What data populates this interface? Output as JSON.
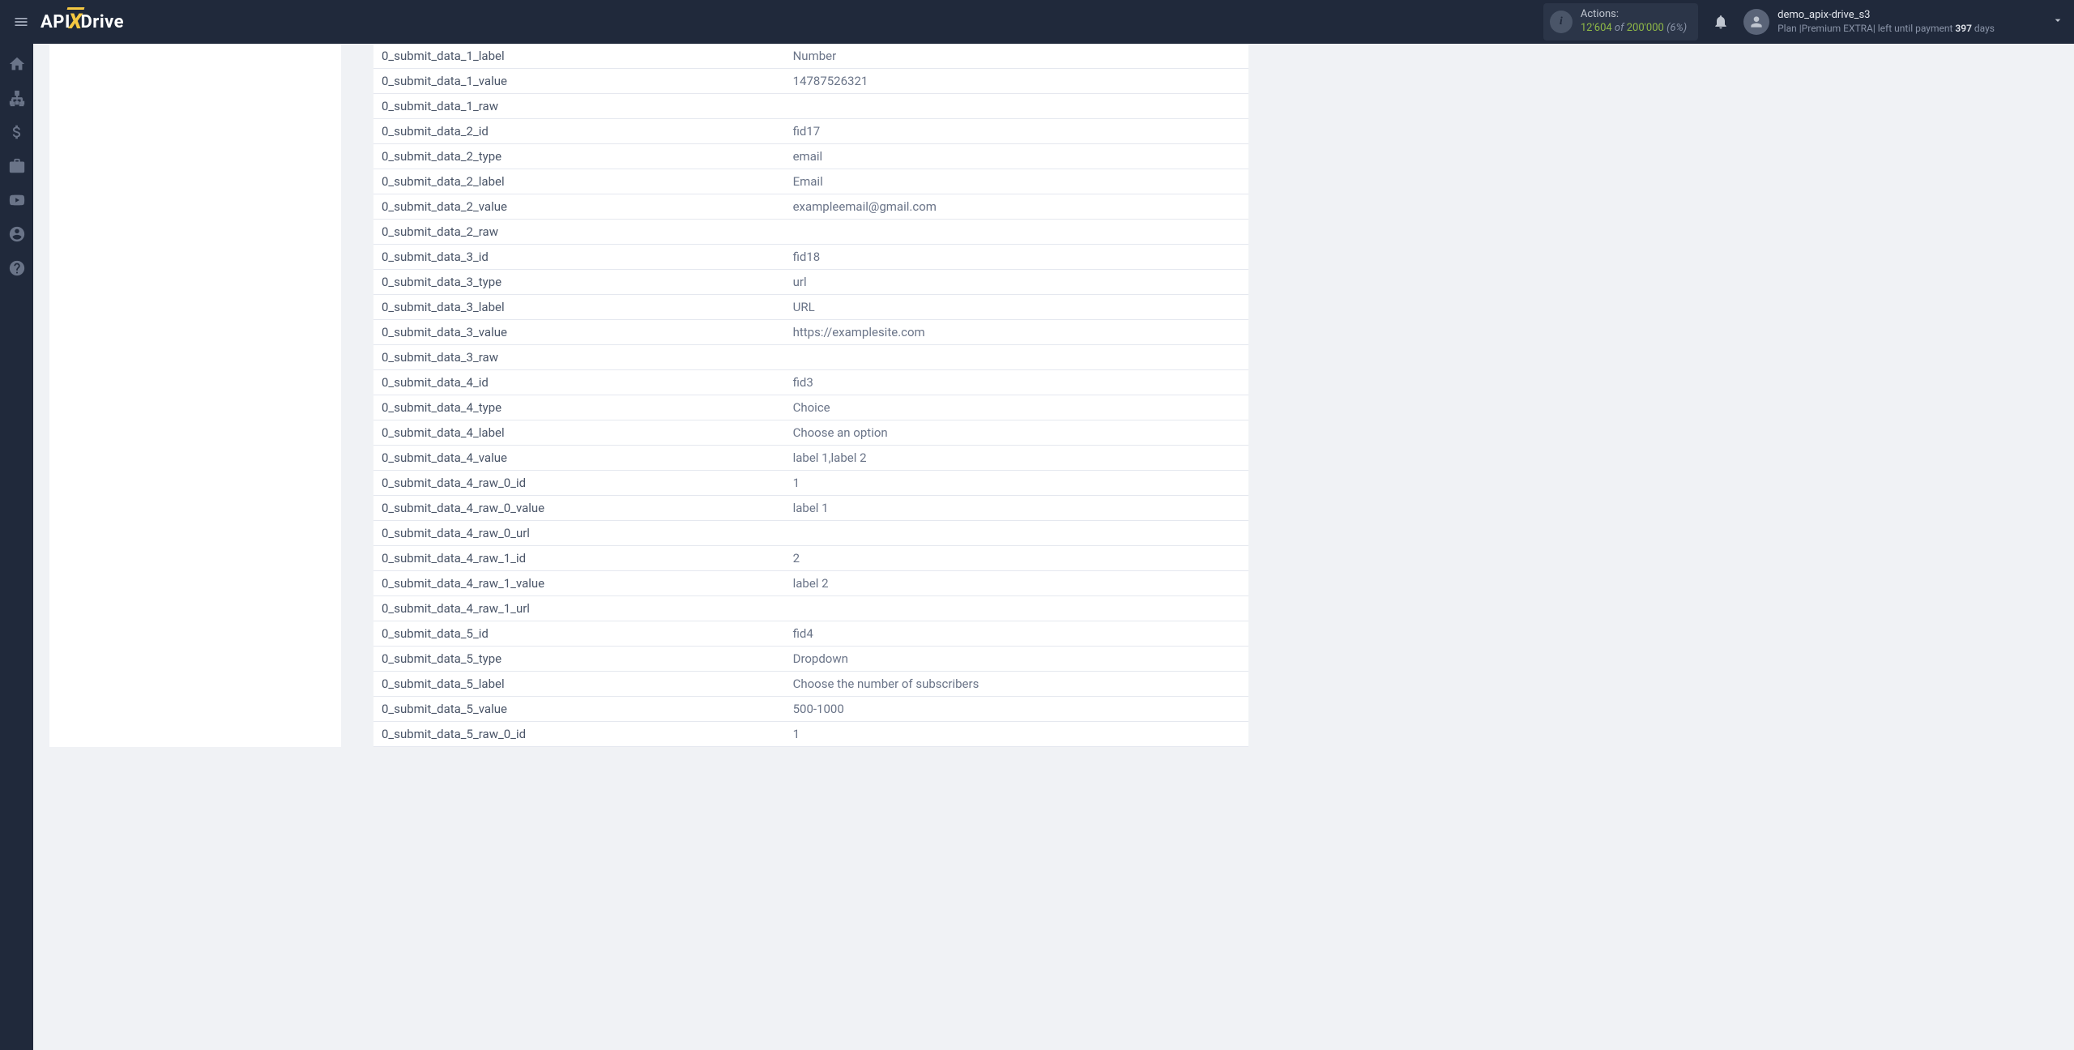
{
  "topbar": {
    "actions_label": "Actions:",
    "actions_n1": "12'604",
    "actions_of": "of",
    "actions_n2": "200'000",
    "actions_pct": "(6%)"
  },
  "user": {
    "name": "demo_apix-drive_s3",
    "plan_prefix": "Plan |",
    "plan_name": "Premium EXTRA",
    "plan_mid": "| left until payment ",
    "plan_days": "397",
    "plan_suffix": " days"
  },
  "rows": [
    {
      "k": "0_submit_data_1_label",
      "v": "Number"
    },
    {
      "k": "0_submit_data_1_value",
      "v": "14787526321"
    },
    {
      "k": "0_submit_data_1_raw",
      "v": ""
    },
    {
      "k": "0_submit_data_2_id",
      "v": "fid17"
    },
    {
      "k": "0_submit_data_2_type",
      "v": "email"
    },
    {
      "k": "0_submit_data_2_label",
      "v": "Email"
    },
    {
      "k": "0_submit_data_2_value",
      "v": "exampleemail@gmail.com"
    },
    {
      "k": "0_submit_data_2_raw",
      "v": ""
    },
    {
      "k": "0_submit_data_3_id",
      "v": "fid18"
    },
    {
      "k": "0_submit_data_3_type",
      "v": "url"
    },
    {
      "k": "0_submit_data_3_label",
      "v": "URL"
    },
    {
      "k": "0_submit_data_3_value",
      "v": "https://examplesite.com"
    },
    {
      "k": "0_submit_data_3_raw",
      "v": ""
    },
    {
      "k": "0_submit_data_4_id",
      "v": "fid3"
    },
    {
      "k": "0_submit_data_4_type",
      "v": "Choice"
    },
    {
      "k": "0_submit_data_4_label",
      "v": "Choose an option"
    },
    {
      "k": "0_submit_data_4_value",
      "v": "label 1,label 2"
    },
    {
      "k": "0_submit_data_4_raw_0_id",
      "v": "1"
    },
    {
      "k": "0_submit_data_4_raw_0_value",
      "v": "label 1"
    },
    {
      "k": "0_submit_data_4_raw_0_url",
      "v": ""
    },
    {
      "k": "0_submit_data_4_raw_1_id",
      "v": "2"
    },
    {
      "k": "0_submit_data_4_raw_1_value",
      "v": "label 2"
    },
    {
      "k": "0_submit_data_4_raw_1_url",
      "v": ""
    },
    {
      "k": "0_submit_data_5_id",
      "v": "fid4"
    },
    {
      "k": "0_submit_data_5_type",
      "v": "Dropdown"
    },
    {
      "k": "0_submit_data_5_label",
      "v": "Choose the number of subscribers"
    },
    {
      "k": "0_submit_data_5_value",
      "v": "500-1000"
    },
    {
      "k": "0_submit_data_5_raw_0_id",
      "v": "1"
    }
  ]
}
